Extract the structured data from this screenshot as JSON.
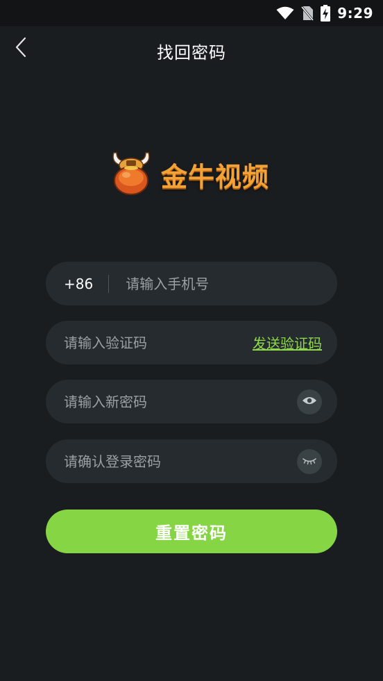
{
  "status_bar": {
    "time": "9:29",
    "icons": [
      "wifi-icon",
      "no-sim-icon",
      "battery-charging-icon"
    ]
  },
  "header": {
    "back_icon": "chevron-left-icon",
    "title": "找回密码"
  },
  "logo": {
    "text": "金牛视频",
    "mascot_icon": "bull-mascot-icon"
  },
  "form": {
    "phone": {
      "country_code": "+86",
      "value": "",
      "placeholder": "请输入手机号"
    },
    "code": {
      "value": "",
      "placeholder": "请输入验证码",
      "send_label": "发送验证码"
    },
    "new_password": {
      "value": "",
      "placeholder": "请输入新密码",
      "toggle_icon": "eye-open-icon"
    },
    "confirm_password": {
      "value": "",
      "placeholder": "请确认登录密码",
      "toggle_icon": "eye-closed-icon"
    },
    "submit_label": "重置密码"
  },
  "colors": {
    "background": "#1a1d20",
    "field_bg": "#252b2e",
    "accent_green": "#86d545",
    "link_green": "#8dd84a",
    "logo_orange": "#f2a236"
  }
}
